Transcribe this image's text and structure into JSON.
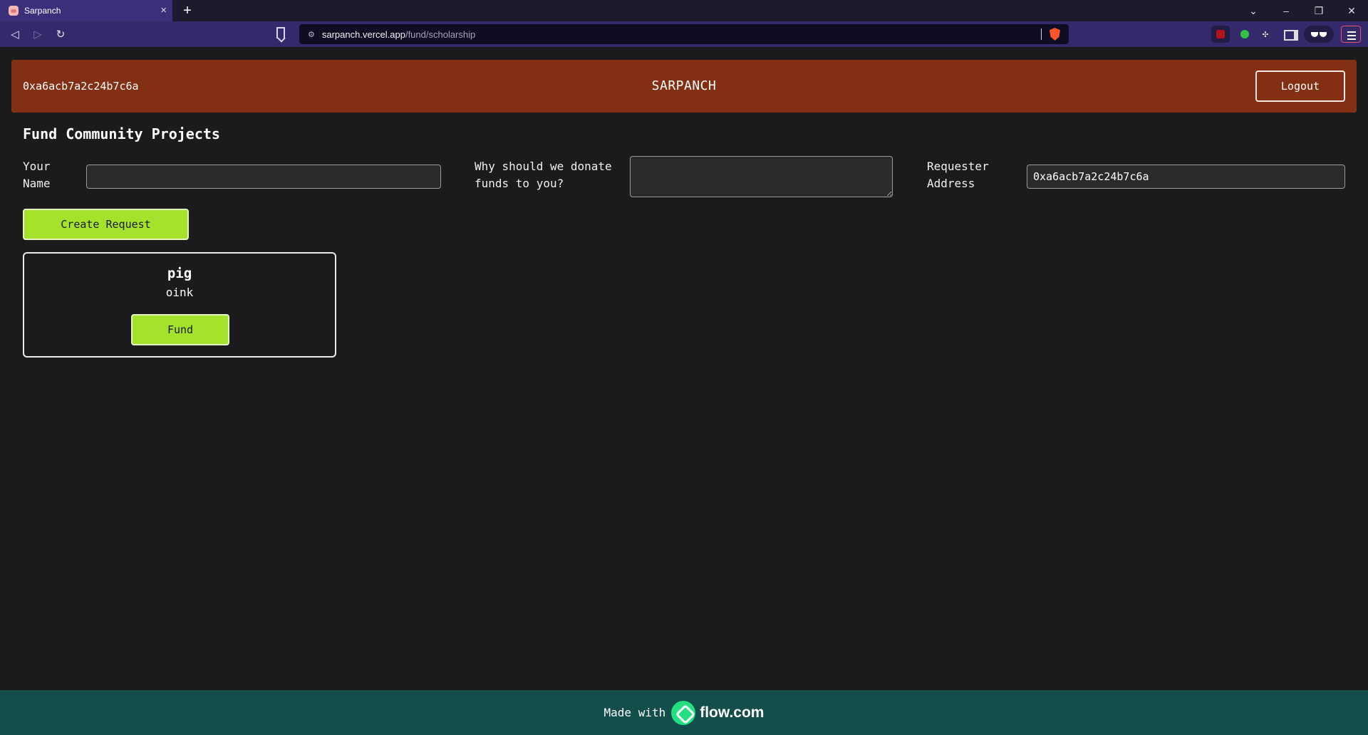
{
  "browser": {
    "tab_title": "Sarpanch",
    "tab_close": "×",
    "new_tab": "+",
    "url_host": "sarpanch.vercel.app",
    "url_path": "/fund/scholarship",
    "window_controls": [
      "⌄",
      "–",
      "❐",
      "✕"
    ]
  },
  "header": {
    "wallet": "0xa6acb7a2c24b7c6a",
    "brand": "SARPANCH",
    "logout_label": "Logout"
  },
  "main": {
    "title": "Fund Community Projects",
    "name_label": "Your Name",
    "name_value": "",
    "reason_label": "Why should we donate funds to you?",
    "reason_value": "",
    "address_label": "Requester Address",
    "address_value": "0xa6acb7a2c24b7c6a",
    "create_label": "Create Request"
  },
  "requests": [
    {
      "name": "pig",
      "description": "oink",
      "fund_label": "Fund"
    }
  ],
  "footer": {
    "made_with": "Made with",
    "brand": "flow.com"
  },
  "colors": {
    "header_bg": "#822f14",
    "accent_green": "#a4e22c",
    "footer_bg": "#134e4a",
    "page_bg": "#1b1b1d"
  }
}
